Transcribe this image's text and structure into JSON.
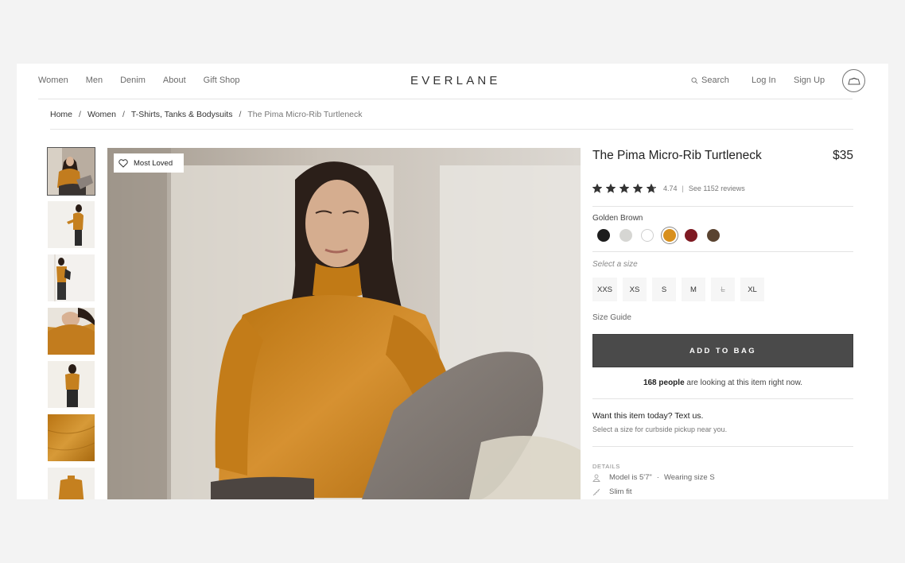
{
  "nav": {
    "left": [
      "Women",
      "Men",
      "Denim",
      "About",
      "Gift Shop"
    ],
    "logo": "EVERLANE",
    "search": "Search",
    "login": "Log In",
    "signup": "Sign Up"
  },
  "breadcrumb": [
    "Home",
    "Women",
    "T-Shirts, Tanks & Bodysuits",
    "The Pima Micro-Rib Turtleneck"
  ],
  "badge": "Most Loved",
  "product": {
    "title": "The Pima Micro-Rib Turtleneck",
    "price": "$35",
    "rating": 4.74,
    "rating_text": "4.74",
    "separator": "|",
    "reviews": "See 1152 reviews",
    "color_name": "Golden Brown",
    "colors": [
      "#1d1d1d",
      "#d6d6d3",
      "#ffffff",
      "#d8901e",
      "#7e1a22",
      "#5a4330"
    ],
    "selected_color_index": 3,
    "size_prompt": "Select a size",
    "sizes": [
      "XXS",
      "XS",
      "S",
      "M",
      "L",
      "XL"
    ],
    "unavailable_sizes": [
      "L"
    ],
    "size_guide": "Size Guide",
    "add_to_bag": "ADD TO BAG",
    "viewers_count": "168 people",
    "viewers_text": " are looking at this item right now.",
    "want_title": "Want this item today? Text us.",
    "want_sub": "Select a size for curbside pickup near you.",
    "details_label": "DETAILS",
    "detail_model": "Model is 5'7\"",
    "detail_dot": "·",
    "detail_size": "Wearing size S",
    "detail_fit": "Slim fit"
  },
  "colors": {
    "accent_button": "#4a4a4a",
    "garment": "#c8821d"
  }
}
